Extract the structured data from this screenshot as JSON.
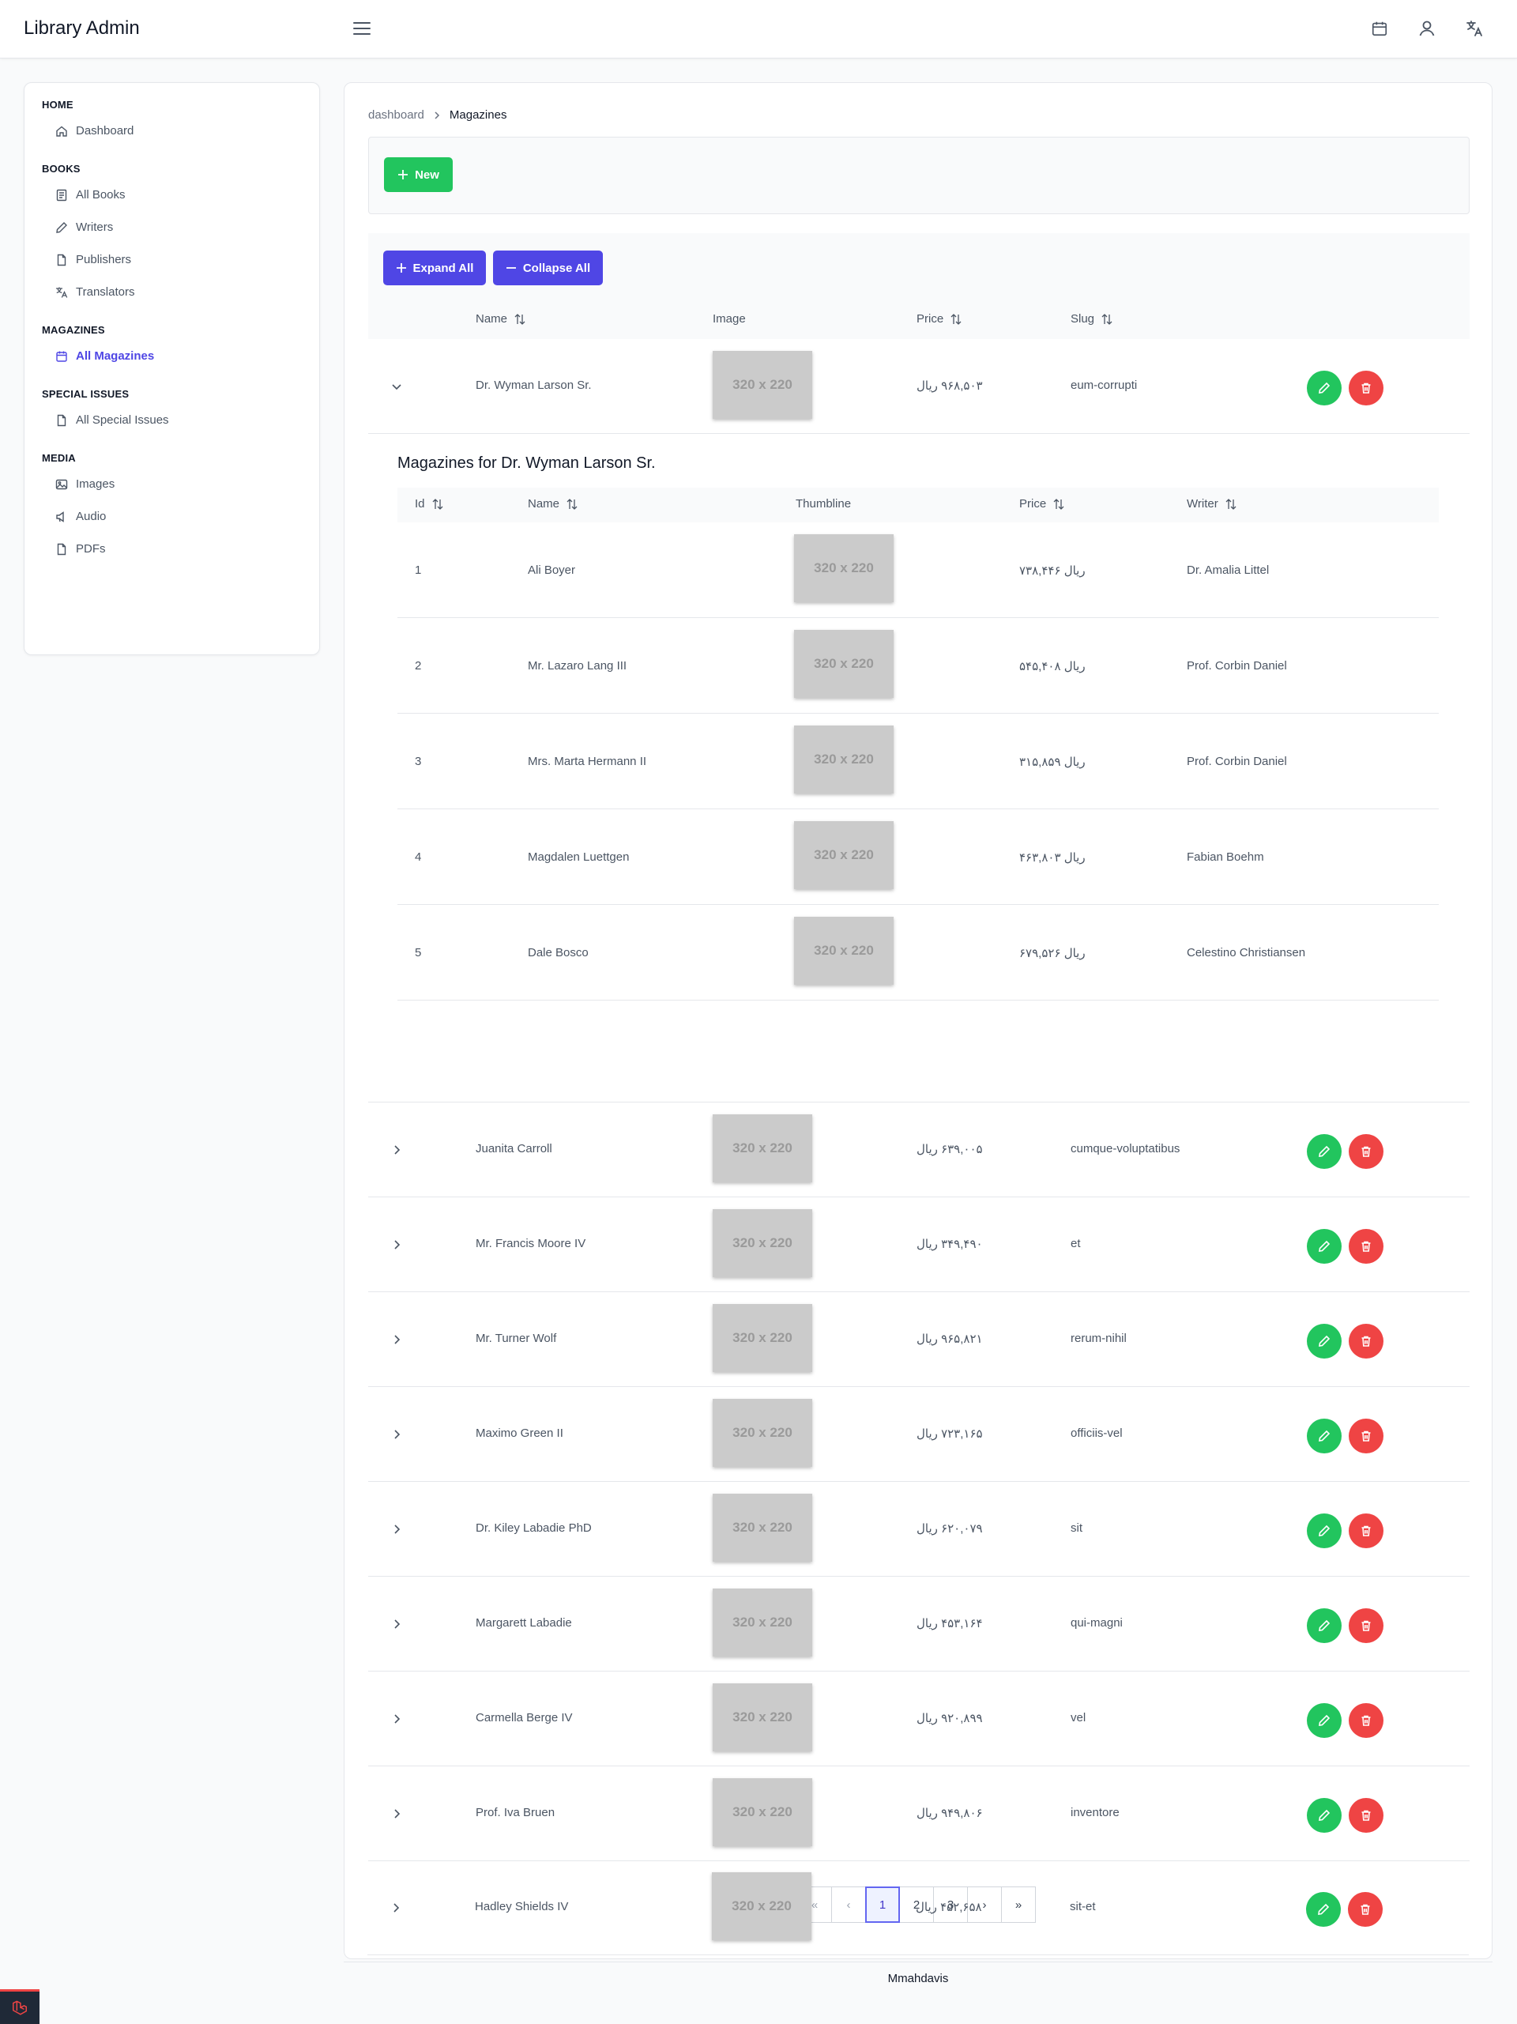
{
  "app": {
    "title": "Library Admin"
  },
  "header": {
    "icons": [
      "hamburger-icon",
      "calendar-icon",
      "user-icon",
      "translate-icon"
    ]
  },
  "sidebar": {
    "sections": [
      {
        "title": "HOME",
        "items": [
          {
            "label": "Dashboard",
            "icon": "home-icon"
          }
        ]
      },
      {
        "title": "BOOKS",
        "items": [
          {
            "label": "All Books",
            "icon": "book-icon"
          },
          {
            "label": "Writers",
            "icon": "pen-icon"
          },
          {
            "label": "Publishers",
            "icon": "file-icon"
          },
          {
            "label": "Translators",
            "icon": "translate-icon"
          }
        ]
      },
      {
        "title": "MAGAZINES",
        "items": [
          {
            "label": "All Magazines",
            "icon": "calendar-icon",
            "active": true
          }
        ]
      },
      {
        "title": "SPECIAL ISSUES",
        "items": [
          {
            "label": "All Special Issues",
            "icon": "file-icon"
          }
        ]
      },
      {
        "title": "MEDIA",
        "items": [
          {
            "label": "Images",
            "icon": "image-icon"
          },
          {
            "label": "Audio",
            "icon": "speaker-icon"
          },
          {
            "label": "PDFs",
            "icon": "file-icon"
          }
        ]
      }
    ]
  },
  "breadcrumb": {
    "parent": "dashboard",
    "current": "Magazines"
  },
  "toolbar": {
    "new_label": "New",
    "expand_label": "Expand All",
    "collapse_label": "Collapse All"
  },
  "table": {
    "columns": {
      "name": "Name",
      "image": "Image",
      "price": "Price",
      "slug": "Slug"
    },
    "thumb_text": "320 x 220",
    "rows": [
      {
        "name": "Dr. Wyman Larson Sr.",
        "price": "۹۶۸,۵۰۳ ریال",
        "slug": "eum-corrupti",
        "expanded": true
      },
      {
        "name": "Juanita Carroll",
        "price": "۶۳۹,۰۰۵ ریال",
        "slug": "cumque-voluptatibus"
      },
      {
        "name": "Mr. Francis Moore IV",
        "price": "۳۴۹,۴۹۰ ریال",
        "slug": "et"
      },
      {
        "name": "Mr. Turner Wolf",
        "price": "۹۶۵,۸۲۱ ریال",
        "slug": "rerum-nihil"
      },
      {
        "name": "Maximo Green II",
        "price": "۷۲۳,۱۶۵ ریال",
        "slug": "officiis-vel"
      },
      {
        "name": "Dr. Kiley Labadie PhD",
        "price": "۶۲۰,۰۷۹ ریال",
        "slug": "sit"
      },
      {
        "name": "Margarett Labadie",
        "price": "۴۵۳,۱۶۴ ریال",
        "slug": "qui-magni"
      },
      {
        "name": "Carmella Berge IV",
        "price": "۹۲۰,۸۹۹ ریال",
        "slug": "vel"
      },
      {
        "name": "Prof. Iva Bruen",
        "price": "۹۴۹,۸۰۶ ریال",
        "slug": "inventore"
      },
      {
        "name": "Hadley Shields IV",
        "price": "۴۵۲,۶۵۸ ریال",
        "slug": "sit-et"
      }
    ]
  },
  "expansion": {
    "title": "Magazines for Dr. Wyman Larson Sr.",
    "columns": {
      "id": "Id",
      "name": "Name",
      "thumb": "Thumbline",
      "price": "Price",
      "writer": "Writer"
    },
    "rows": [
      {
        "id": "1",
        "name": "Ali Boyer",
        "price": "۷۳۸,۴۴۶ ریال",
        "writer": "Dr. Amalia Littel"
      },
      {
        "id": "2",
        "name": "Mr. Lazaro Lang III",
        "price": "۵۴۵,۴۰۸ ریال",
        "writer": "Prof. Corbin Daniel"
      },
      {
        "id": "3",
        "name": "Mrs. Marta Hermann II",
        "price": "۳۱۵,۸۵۹ ریال",
        "writer": "Prof. Corbin Daniel"
      },
      {
        "id": "4",
        "name": "Magdalen Luettgen",
        "price": "۴۶۳,۸۰۳ ریال",
        "writer": "Fabian Boehm"
      },
      {
        "id": "5",
        "name": "Dale Bosco",
        "price": "۶۷۹,۵۲۶ ریال",
        "writer": "Celestino Christiansen"
      }
    ]
  },
  "pagination": {
    "first": "«",
    "prev": "‹",
    "pages": [
      "1",
      "2",
      "3"
    ],
    "current": "1",
    "next": "›",
    "last": "»"
  },
  "footer": {
    "text": "Mmahdavis"
  },
  "colors": {
    "accent": "#4f46e5",
    "success": "#22c55e",
    "danger": "#ef4444"
  }
}
